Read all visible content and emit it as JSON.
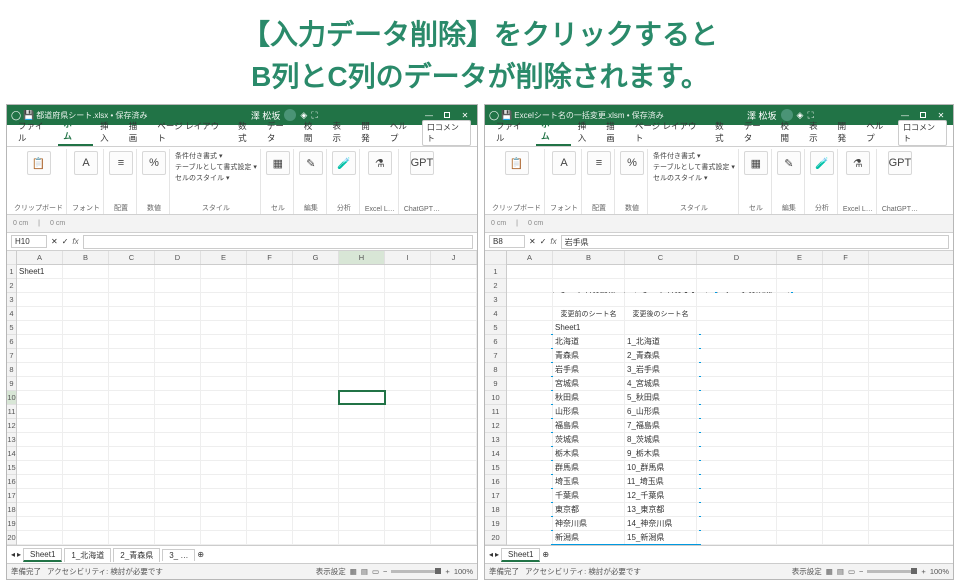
{
  "slide": {
    "line1": "【入力データ削除】をクリックすると",
    "line2": "B列とC列のデータが削除されます。"
  },
  "left_window": {
    "title": "都道府県シート.xlsx • 保存済み",
    "user": "澤 松坂",
    "tabs": [
      "ファイル",
      "ホーム",
      "挿入",
      "描画",
      "ページ レイアウト",
      "数式",
      "データ",
      "校閲",
      "表示",
      "開発",
      "ヘルプ"
    ],
    "active_tab": "ホーム",
    "comment_label": "口コメント",
    "ribbon": {
      "clipboard": "クリップボード",
      "font": "フォント",
      "align": "配置",
      "number": "数値",
      "style_items": [
        "条件付き書式 ▾",
        "テーブルとして書式設定 ▾",
        "セルのスタイル ▾"
      ],
      "style": "スタイル",
      "cells": "セル",
      "edit": "編集",
      "analysis_label": "データ分析",
      "analysis_group": "分析",
      "excel_labs": "Excel Labs",
      "excel_l_group": "Excel L…",
      "chatgpt": "ChatGPT for Excel",
      "chatgpt_group": "ChatGPT…"
    },
    "namebox": "H10",
    "fxvalue": "",
    "cols": [
      "A",
      "B",
      "C",
      "D",
      "E",
      "F",
      "G",
      "H",
      "I",
      "J"
    ],
    "rows_count": 20,
    "selected_row": 10,
    "selected_col": "H",
    "a1": "Sheet1",
    "sheet_tabs": [
      "Sheet1",
      "1_北海道",
      "2_青森県",
      "3_ …"
    ],
    "status": {
      "ready": "準備完了",
      "ax": "アクセシビリティ: 検討が必要です",
      "settings": "表示設定",
      "zoom": "100%"
    }
  },
  "right_window": {
    "title": "Excelシート名の一括変更.xlsm • 保存済み",
    "user": "澤 松坂",
    "tabs": [
      "ファイル",
      "ホーム",
      "挿入",
      "描画",
      "ページ レイアウト",
      "数式",
      "データ",
      "校閲",
      "表示",
      "開発",
      "ヘルプ"
    ],
    "active_tab": "ホーム",
    "comment_label": "口コメント",
    "ribbon": {
      "clipboard": "クリップボード",
      "font": "フォント",
      "align": "配置",
      "number": "数値",
      "style_items": [
        "条件付き書式 ▾",
        "テーブルとして書式設定 ▾",
        "セルのスタイル ▾"
      ],
      "style": "スタイル",
      "cells": "セル",
      "edit": "編集",
      "analysis_label": "データ分析",
      "analysis_group": "分析",
      "excel_labs": "Excel Labs",
      "excel_l_group": "Excel L…",
      "chatgpt": "ChatGPT for Excel",
      "chatgpt_group": "ChatGPT…"
    },
    "namebox": "B8",
    "fxvalue": "岩手県",
    "cols": [
      "A",
      "B",
      "C",
      "D",
      "E",
      "F"
    ],
    "rows_count": 20,
    "buttons": {
      "get": "シート名の取得",
      "rename": "シート名の変更",
      "delete": "データの削除"
    },
    "hdr_b": "変更前のシート名",
    "hdr_c": "変更後のシート名",
    "data": [
      {
        "b": "Sheet1",
        "c": ""
      },
      {
        "b": "北海道",
        "c": "1_北海道"
      },
      {
        "b": "青森県",
        "c": "2_青森県"
      },
      {
        "b": "岩手県",
        "c": "3_岩手県"
      },
      {
        "b": "宮城県",
        "c": "4_宮城県"
      },
      {
        "b": "秋田県",
        "c": "5_秋田県"
      },
      {
        "b": "山形県",
        "c": "6_山形県"
      },
      {
        "b": "福島県",
        "c": "7_福島県"
      },
      {
        "b": "茨城県",
        "c": "8_茨城県"
      },
      {
        "b": "栃木県",
        "c": "9_栃木県"
      },
      {
        "b": "群馬県",
        "c": "10_群馬県"
      },
      {
        "b": "埼玉県",
        "c": "11_埼玉県"
      },
      {
        "b": "千葉県",
        "c": "12_千葉県"
      },
      {
        "b": "東京都",
        "c": "13_東京都"
      },
      {
        "b": "神奈川県",
        "c": "14_神奈川県"
      },
      {
        "b": "新潟県",
        "c": "15_新潟県"
      }
    ],
    "sheet_tabs": [
      "Sheet1"
    ],
    "status": {
      "ready": "準備完了",
      "ax": "アクセシビリティ: 検討が必要です",
      "settings": "表示設定",
      "zoom": "100%"
    }
  }
}
